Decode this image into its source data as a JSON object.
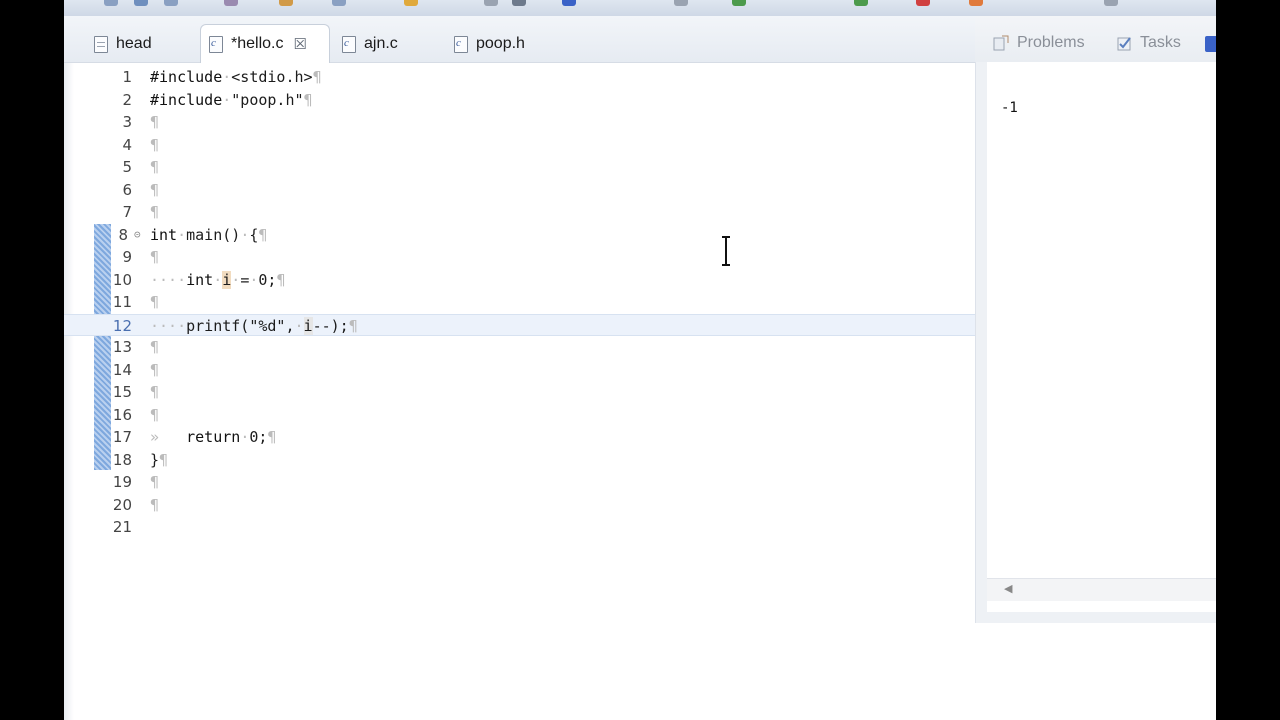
{
  "editor": {
    "tabs": [
      {
        "label": "head",
        "icon": "header-file-icon",
        "active": false
      },
      {
        "label": "*hello.c",
        "icon": "c-file-icon",
        "active": true,
        "closable": true
      },
      {
        "label": "ajn.c",
        "icon": "c-file-icon",
        "active": false
      },
      {
        "label": "poop.h",
        "icon": "c-file-icon",
        "active": false
      }
    ],
    "close_glyph": "☒",
    "pilcrow": "¶",
    "fold_marker": "⊝",
    "line_numbers": [
      "1",
      "2",
      "3",
      "4",
      "5",
      "6",
      "7",
      "8",
      "9",
      "10",
      "11",
      "12",
      "13",
      "14",
      "15",
      "16",
      "17",
      "18",
      "19",
      "20",
      "21"
    ],
    "current_line": "12"
  },
  "side_view": {
    "tabs": [
      {
        "label": "Problems",
        "icon": "problems-icon"
      },
      {
        "label": "Tasks",
        "icon": "tasks-icon"
      }
    ],
    "console_output": "-1"
  },
  "colors": {
    "accent": "#4a6fb0",
    "highlight": "#f2dcc0"
  }
}
